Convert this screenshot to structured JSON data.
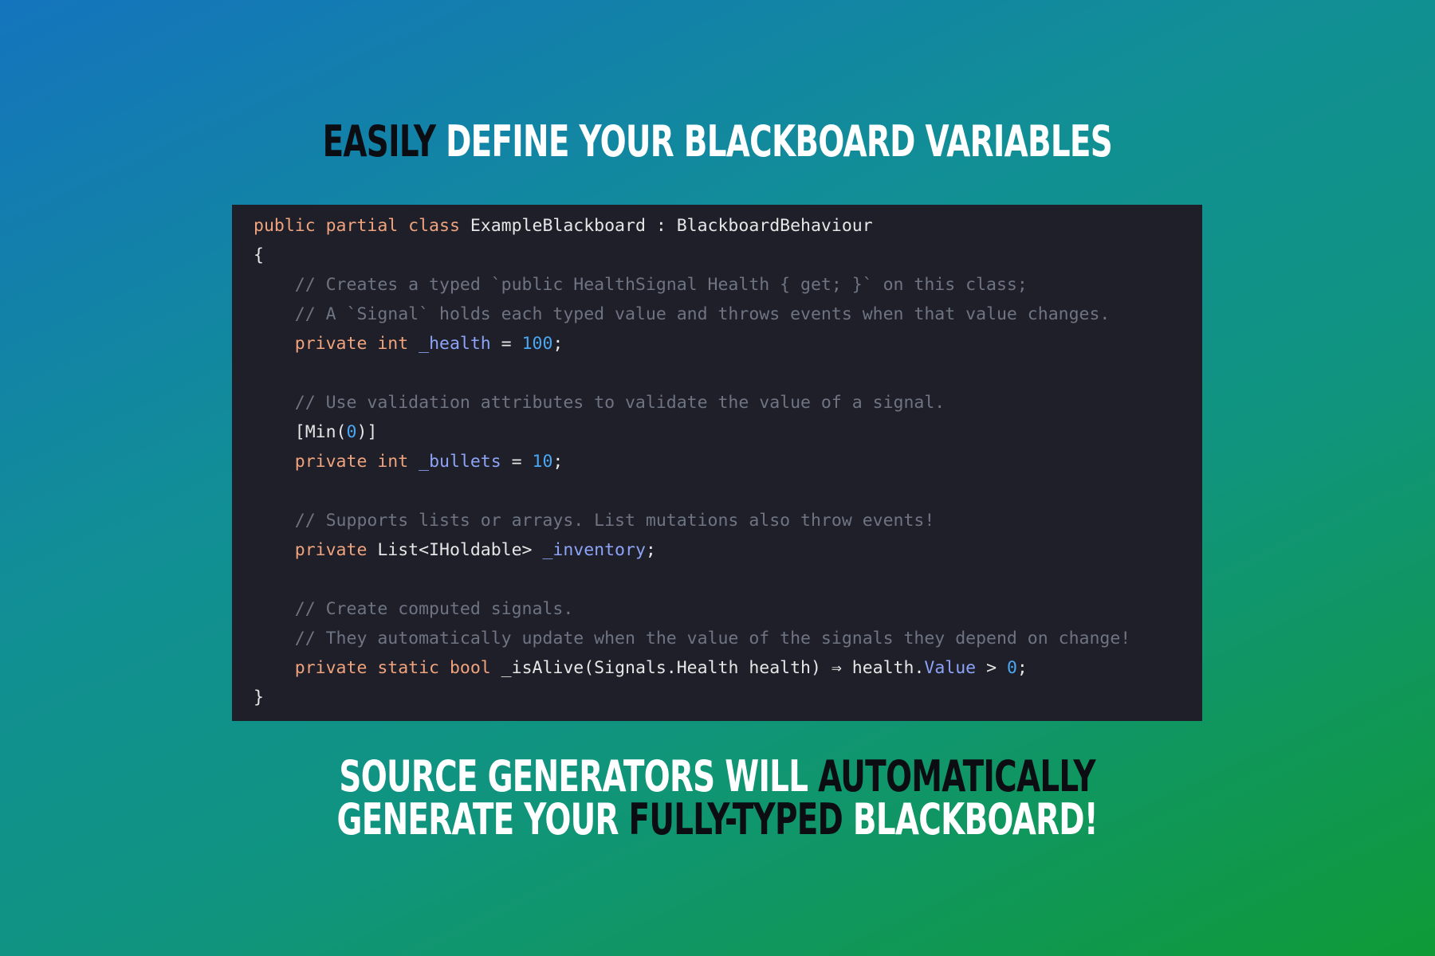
{
  "heading": {
    "word_dark": "EASILY",
    "rest": " DEFINE YOUR BLACKBOARD VARIABLES"
  },
  "footer": {
    "line1_white": "SOURCE GENERATORS WILL ",
    "line1_dark": "AUTOMATICALLY",
    "line2_white_a": "GENERATE YOUR ",
    "line2_dark": "FULLY-TYPED",
    "line2_white_b": " BLACKBOARD!"
  },
  "code": {
    "l1": {
      "kw": "public partial class",
      "rest": " ExampleBlackboard : BlackboardBehaviour"
    },
    "l2": "{",
    "l3": "    // Creates a typed `public HealthSignal Health { get; }` on this class;",
    "l4": "    // A `Signal` holds each typed value and throws events when that value changes.",
    "l5": {
      "indent": "    ",
      "kw": "private int",
      "sp": " ",
      "field": "_health",
      "eq": " = ",
      "num": "100",
      "end": ";"
    },
    "l6": "",
    "l7": "    // Use validation attributes to validate the value of a signal.",
    "l8": {
      "pre": "    [Min(",
      "num": "0",
      "post": ")]"
    },
    "l9": {
      "indent": "    ",
      "kw": "private int",
      "sp": " ",
      "field": "_bullets",
      "eq": " = ",
      "num": "10",
      "end": ";"
    },
    "l10": "",
    "l11": "    // Supports lists or arrays. List mutations also throw events!",
    "l12": {
      "indent": "    ",
      "kw": "private",
      "type": " List<IHoldable> ",
      "field": "_inventory",
      "end": ";"
    },
    "l13": "",
    "l14": "    // Create computed signals.",
    "l15": "    // They automatically update when the value of the signals they depend on change!",
    "l16": {
      "indent": "    ",
      "kw": "private static bool",
      "mid": " _isAlive(Signals.Health health) ⇒ health.",
      "field": "Value",
      "gt": " > ",
      "num": "0",
      "end": ";"
    },
    "l17": "}"
  }
}
